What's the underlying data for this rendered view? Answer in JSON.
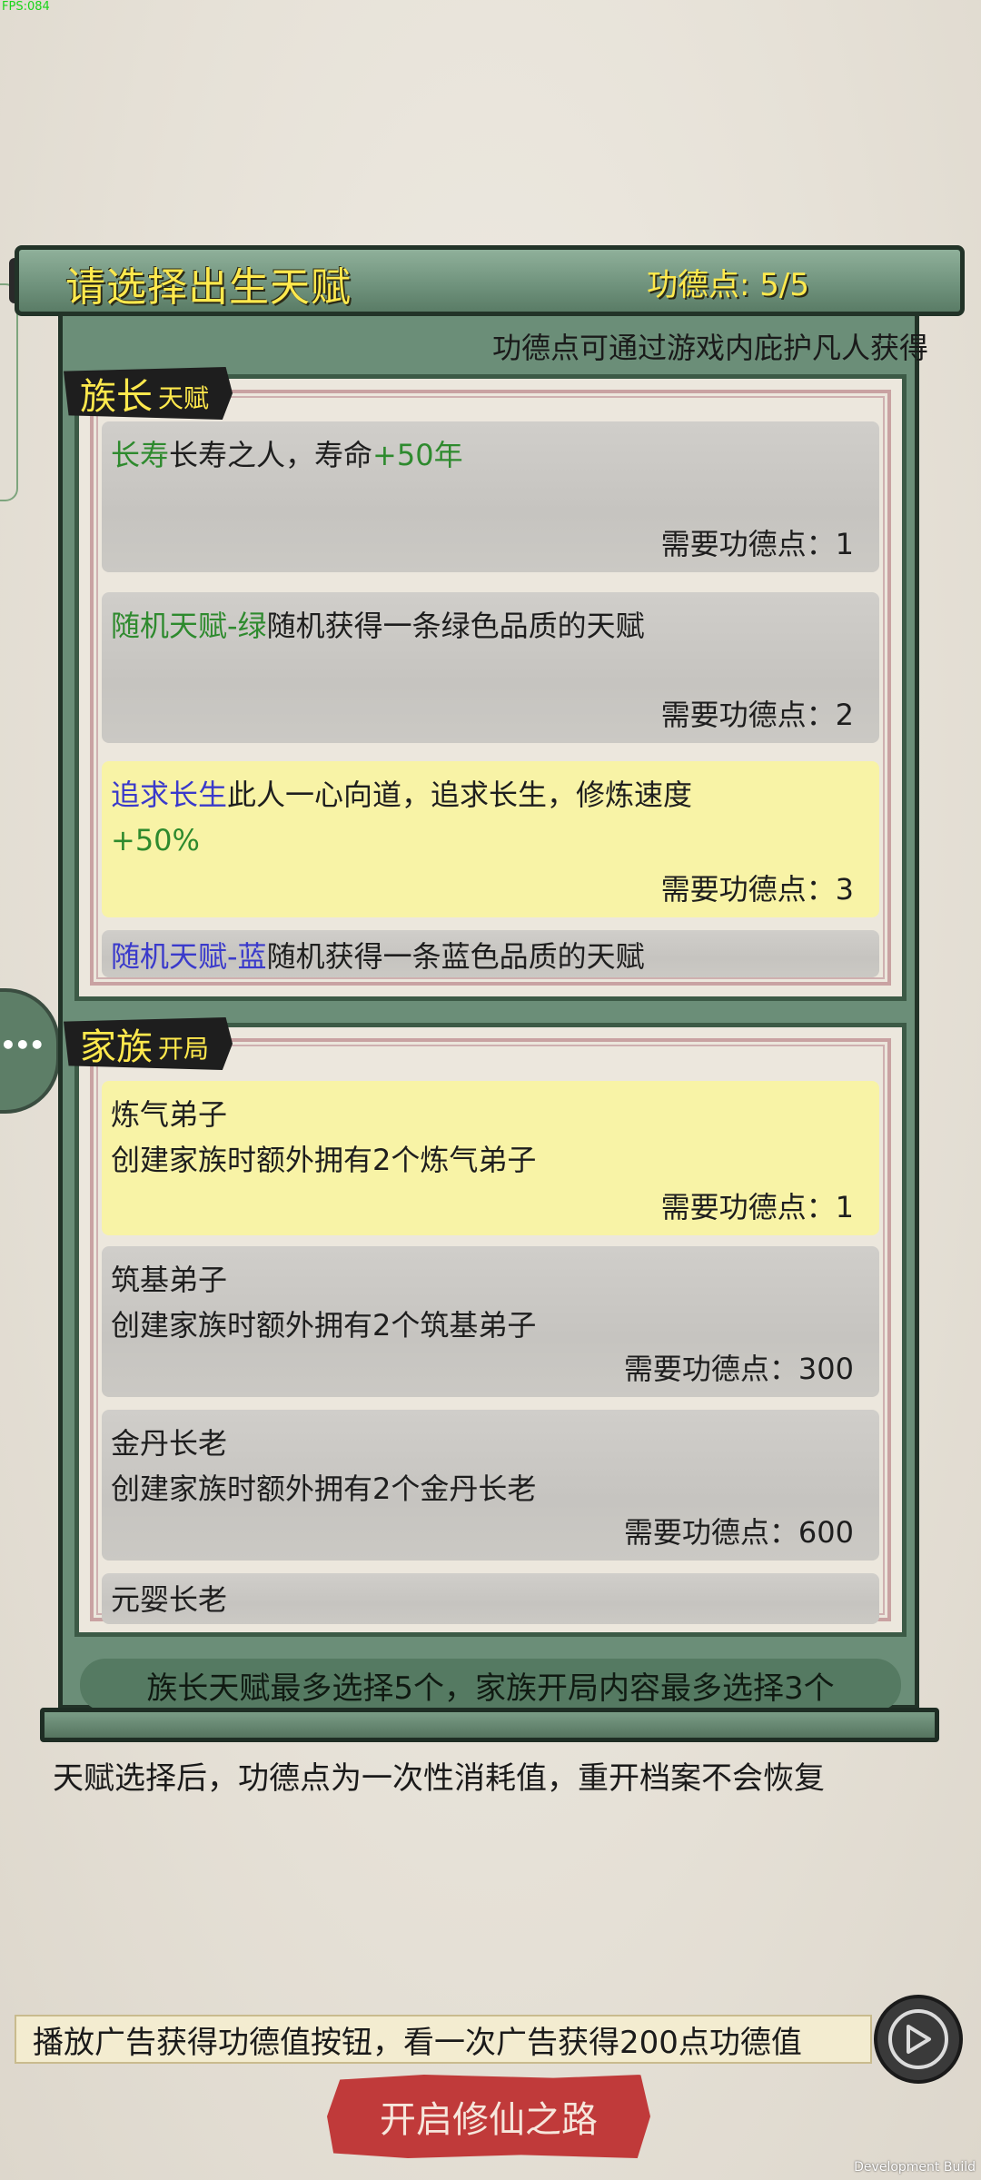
{
  "debug": {
    "fps": "FPS:084",
    "build": "Development Build"
  },
  "header": {
    "title": "请选择出生天赋",
    "merit_label": "功德点: 5/5",
    "merit_note": "功德点可通过游戏内庇护凡人获得"
  },
  "sections": {
    "leader": {
      "name": "族长",
      "sub": "天赋"
    },
    "family": {
      "name": "家族",
      "sub": "开局"
    }
  },
  "leader_items": [
    {
      "name": "长寿",
      "desc": "长寿之人，寿命",
      "bonus": "+50年",
      "cost": "需要功德点：1"
    },
    {
      "name": "随机天赋-绿",
      "desc": "随机获得一条绿色品质的天赋",
      "cost": "需要功德点：2"
    },
    {
      "name": "追求长生",
      "desc": "此人一心向道，追求长生，修炼速度",
      "bonus": "+50%",
      "cost": "需要功德点：3"
    },
    {
      "name": "随机天赋-蓝",
      "desc": "随机获得一条蓝色品质的天赋"
    }
  ],
  "family_items": [
    {
      "name": "炼气弟子",
      "desc": "创建家族时额外拥有2个炼气弟子",
      "cost": "需要功德点：1"
    },
    {
      "name": "筑基弟子",
      "desc": "创建家族时额外拥有2个筑基弟子",
      "cost": "需要功德点：300"
    },
    {
      "name": "金丹长老",
      "desc": "创建家族时额外拥有2个金丹长老",
      "cost": "需要功德点：600"
    },
    {
      "name": "元婴长老"
    }
  ],
  "footer": {
    "limit_note": "族长天赋最多选择5个，家族开局内容最多选择3个",
    "warning": "天赋选择后，功德点为一次性消耗值，重开档案不会恢复",
    "ad_text": "播放广告获得功德值按钮，看一次广告获得200点功德值",
    "start_label": "开启修仙之路"
  },
  "icons": {
    "ad": "play-icon",
    "more": "more-dots-icon"
  },
  "colors": {
    "scroll_green": "#6b8e78",
    "title_yellow": "#ffe94d",
    "selected_card": "#f8f3a6",
    "start_red": "#c03a3a"
  }
}
